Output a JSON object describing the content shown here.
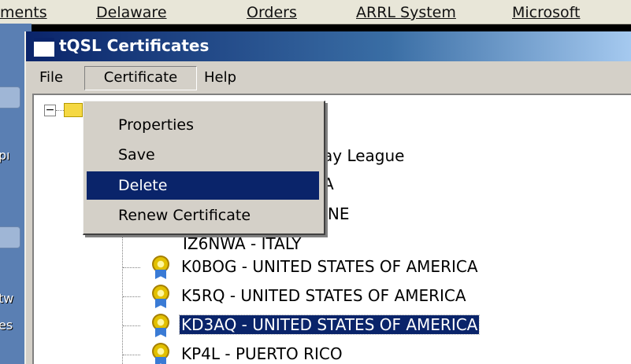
{
  "bookmarks": [
    "ments",
    "Delaware",
    "Orders",
    "ARRL System",
    "Microsoft"
  ],
  "desktop": {
    "labels": [
      "pı",
      "tw",
      "es"
    ]
  },
  "window": {
    "title": "tQSL Certificates"
  },
  "menubar": {
    "file": "File",
    "certificate": "Certificate",
    "help": "Help"
  },
  "dropdown": {
    "items": [
      "Properties",
      "Save",
      "Delete",
      "Renew Certificate"
    ],
    "highlighted": "Delete"
  },
  "tree": {
    "collapse_symbol": "−",
    "partial_lines": [
      "ay League",
      "A",
      "INE",
      "IZ6NWA - ITALY"
    ],
    "items": [
      "K0BOG - UNITED STATES OF AMERICA",
      "K5RQ - UNITED STATES OF AMERICA",
      "KD3AQ - UNITED STATES OF AMERICA",
      "KP4L - PUERTO RICO"
    ],
    "selected_item": "KD3AQ - UNITED STATES OF AMERICA"
  },
  "colors": {
    "title_bar": "#0a246a",
    "selection": "#0a246a",
    "window_face": "#d4d0c8"
  }
}
